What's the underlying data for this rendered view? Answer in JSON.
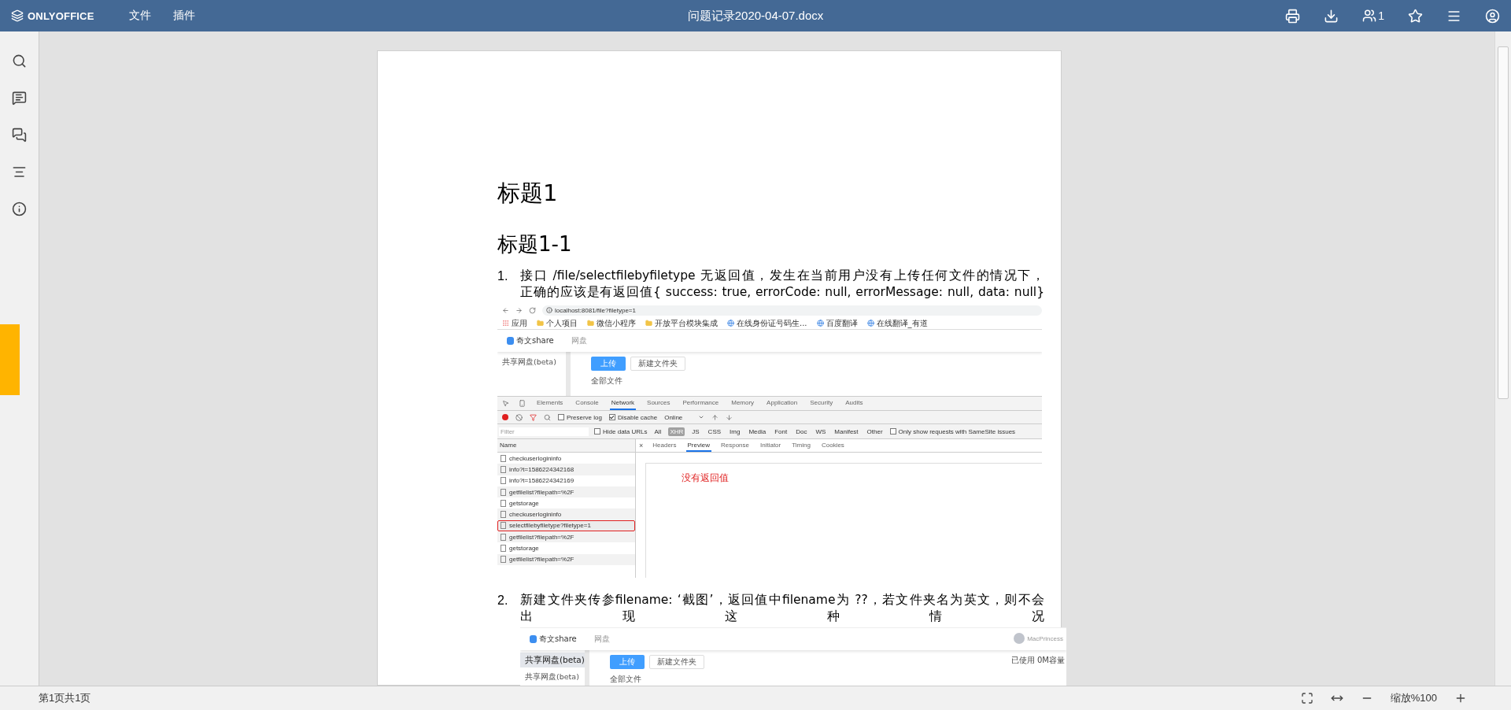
{
  "toolbar": {
    "logo": "ONLYOFFICE",
    "menu": [
      "文件",
      "插件"
    ],
    "title": "问题记录2020-04-07.docx",
    "users_count": "1"
  },
  "document": {
    "heading_1": "标题1",
    "heading_2": "标题1-1",
    "list": [
      {
        "number": "1.",
        "lines": [
          "接口 /file/selectfilebyfiletype 无返回值，发生在当前用户没有上传任何文件的情况下，",
          "正确的应该是有返回值{ success: true, errorCode: null, errorMessage: null, data: null}"
        ],
        "screenshot": {
          "kind": "devtools",
          "url": "localhost:8081/file?filetype=1",
          "bookmarks": [
            {
              "kind": "apps",
              "label": "应用"
            },
            {
              "kind": "folder",
              "label": "个人项目"
            },
            {
              "kind": "folder",
              "label": "微信小程序"
            },
            {
              "kind": "folder",
              "label": "开放平台模块集成"
            },
            {
              "kind": "site",
              "label": "在线身份证号码生..."
            },
            {
              "kind": "site",
              "label": "百度翻译"
            },
            {
              "kind": "site",
              "label": "在线翻译_有道"
            }
          ],
          "app_logo": "奇文share",
          "app_nav": "网盘",
          "sidebar_item": "共享网盘(beta)",
          "upload_button": "上传",
          "new_folder_button": "新建文件夹",
          "breadcrumb": "全部文件",
          "devtools_tabs": [
            {
              "label": "Elements",
              "selected": false
            },
            {
              "label": "Console",
              "selected": false
            },
            {
              "label": "Network",
              "selected": true
            },
            {
              "label": "Sources",
              "selected": false
            },
            {
              "label": "Performance",
              "selected": false
            },
            {
              "label": "Memory",
              "selected": false
            },
            {
              "label": "Application",
              "selected": false
            },
            {
              "label": "Security",
              "selected": false
            },
            {
              "label": "Audits",
              "selected": false
            }
          ],
          "preserve_log": {
            "label": "Preserve log",
            "checked": false
          },
          "disable_cache": {
            "label": "Disable cache",
            "checked": true
          },
          "throttle": "Online",
          "filter_placeholder": "Filter",
          "hide_data_urls": {
            "label": "Hide data URLs",
            "checked": false
          },
          "types": [
            {
              "label": "All",
              "selected": false
            },
            {
              "label": "XHR",
              "selected": true
            },
            {
              "label": "JS",
              "selected": false
            },
            {
              "label": "CSS",
              "selected": false
            },
            {
              "label": "Img",
              "selected": false
            },
            {
              "label": "Media",
              "selected": false
            },
            {
              "label": "Font",
              "selected": false
            },
            {
              "label": "Doc",
              "selected": false
            },
            {
              "label": "WS",
              "selected": false
            },
            {
              "label": "Manifest",
              "selected": false
            },
            {
              "label": "Other",
              "selected": false
            }
          ],
          "samesite": {
            "label": "Only show requests with SameSite issues",
            "checked": false
          },
          "name_header": "Name",
          "requests": [
            {
              "name": "checkuserlogininfo",
              "highlighted": false
            },
            {
              "name": "info?t=1586224342168",
              "highlighted": false
            },
            {
              "name": "info?t=1586224342169",
              "highlighted": false
            },
            {
              "name": "getfilelist?filepath=%2F",
              "highlighted": false
            },
            {
              "name": "getstorage",
              "highlighted": false
            },
            {
              "name": "checkuserlogininfo",
              "highlighted": false
            },
            {
              "name": "selectfilebyfiletype?filetype=1",
              "highlighted": true
            },
            {
              "name": "getfilelist?filepath=%2F",
              "highlighted": false
            },
            {
              "name": "getstorage",
              "highlighted": false
            },
            {
              "name": "getfilelist?filepath=%2F",
              "highlighted": false
            }
          ],
          "close_symbol": "×",
          "detail_tabs": [
            {
              "label": "Headers",
              "selected": false
            },
            {
              "label": "Preview",
              "selected": true
            },
            {
              "label": "Response",
              "selected": false
            },
            {
              "label": "Initiator",
              "selected": false
            },
            {
              "label": "Timing",
              "selected": false
            },
            {
              "label": "Cookies",
              "selected": false
            }
          ],
          "preview_text": "没有返回值"
        }
      },
      {
        "number": "2.",
        "lines": [
          "新建文件夹传参filename: ‘截图’，返回值中filename为 ??，若文件夹名为英文，则不会",
          "出 现 这 种 情 况"
        ],
        "screenshot": {
          "kind": "app",
          "app_logo": "奇文share",
          "app_nav": "网盘",
          "user": "MacPrincess",
          "sidebar_items": [
            {
              "label": "共享网盘(beta)",
              "selected": true
            },
            {
              "label": "共享网盘(beta)",
              "selected": false
            }
          ],
          "upload_button": "上传",
          "new_folder_button": "新建文件夹",
          "breadcrumb": "全部文件",
          "usage": "已使用 0M容量"
        }
      }
    ]
  },
  "status_bar": {
    "page": "第1页共1页",
    "zoom": "缩放%100"
  }
}
